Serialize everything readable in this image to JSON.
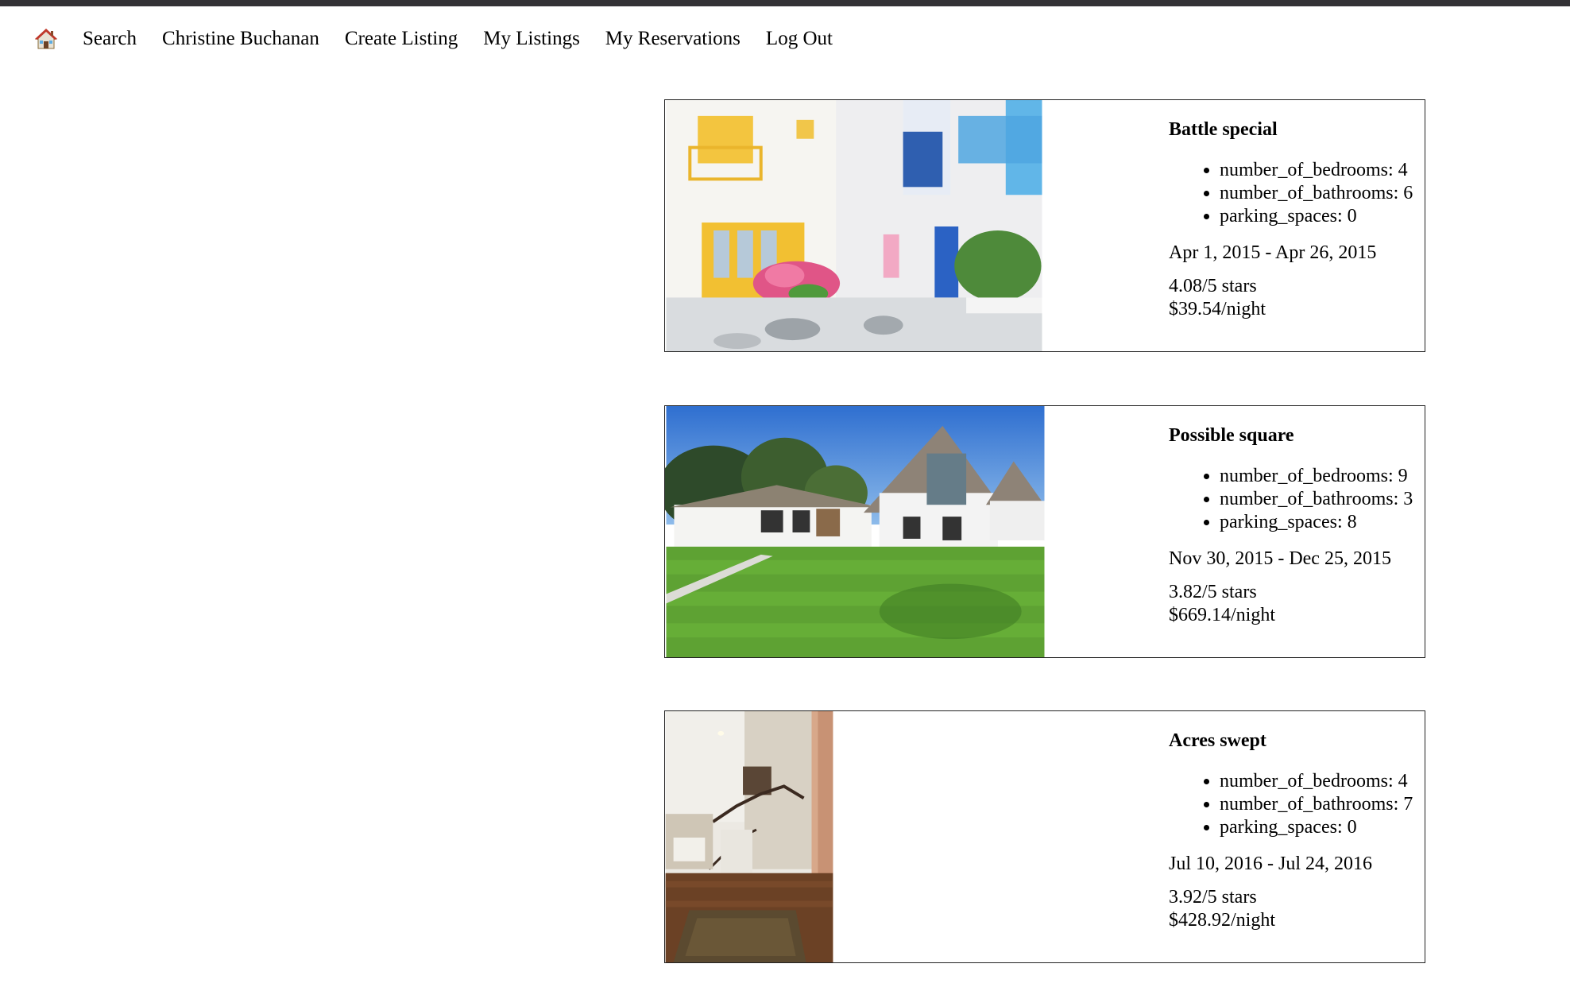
{
  "nav": {
    "home_icon": "house-icon",
    "items": [
      {
        "label": "Search"
      },
      {
        "label": "Christine Buchanan"
      },
      {
        "label": "Create Listing"
      },
      {
        "label": "My Listings"
      },
      {
        "label": "My Reservations"
      },
      {
        "label": "Log Out"
      }
    ]
  },
  "listings": [
    {
      "title": "Battle special",
      "details": [
        "number_of_bedrooms: 4",
        "number_of_bathrooms: 6",
        "parking_spaces: 0"
      ],
      "dates": "Apr 1, 2015 - Apr 26, 2015",
      "rating": "4.08/5 stars",
      "price": "$39.54/night"
    },
    {
      "title": "Possible square",
      "details": [
        "number_of_bedrooms: 9",
        "number_of_bathrooms: 3",
        "parking_spaces: 8"
      ],
      "dates": "Nov 30, 2015 - Dec 25, 2015",
      "rating": "3.82/5 stars",
      "price": "$669.14/night"
    },
    {
      "title": "Acres swept",
      "details": [
        "number_of_bedrooms: 4",
        "number_of_bathrooms: 7",
        "parking_spaces: 0"
      ],
      "dates": "Jul 10, 2016 - Jul 24, 2016",
      "rating": "3.92/5 stars",
      "price": "$428.92/night"
    }
  ]
}
